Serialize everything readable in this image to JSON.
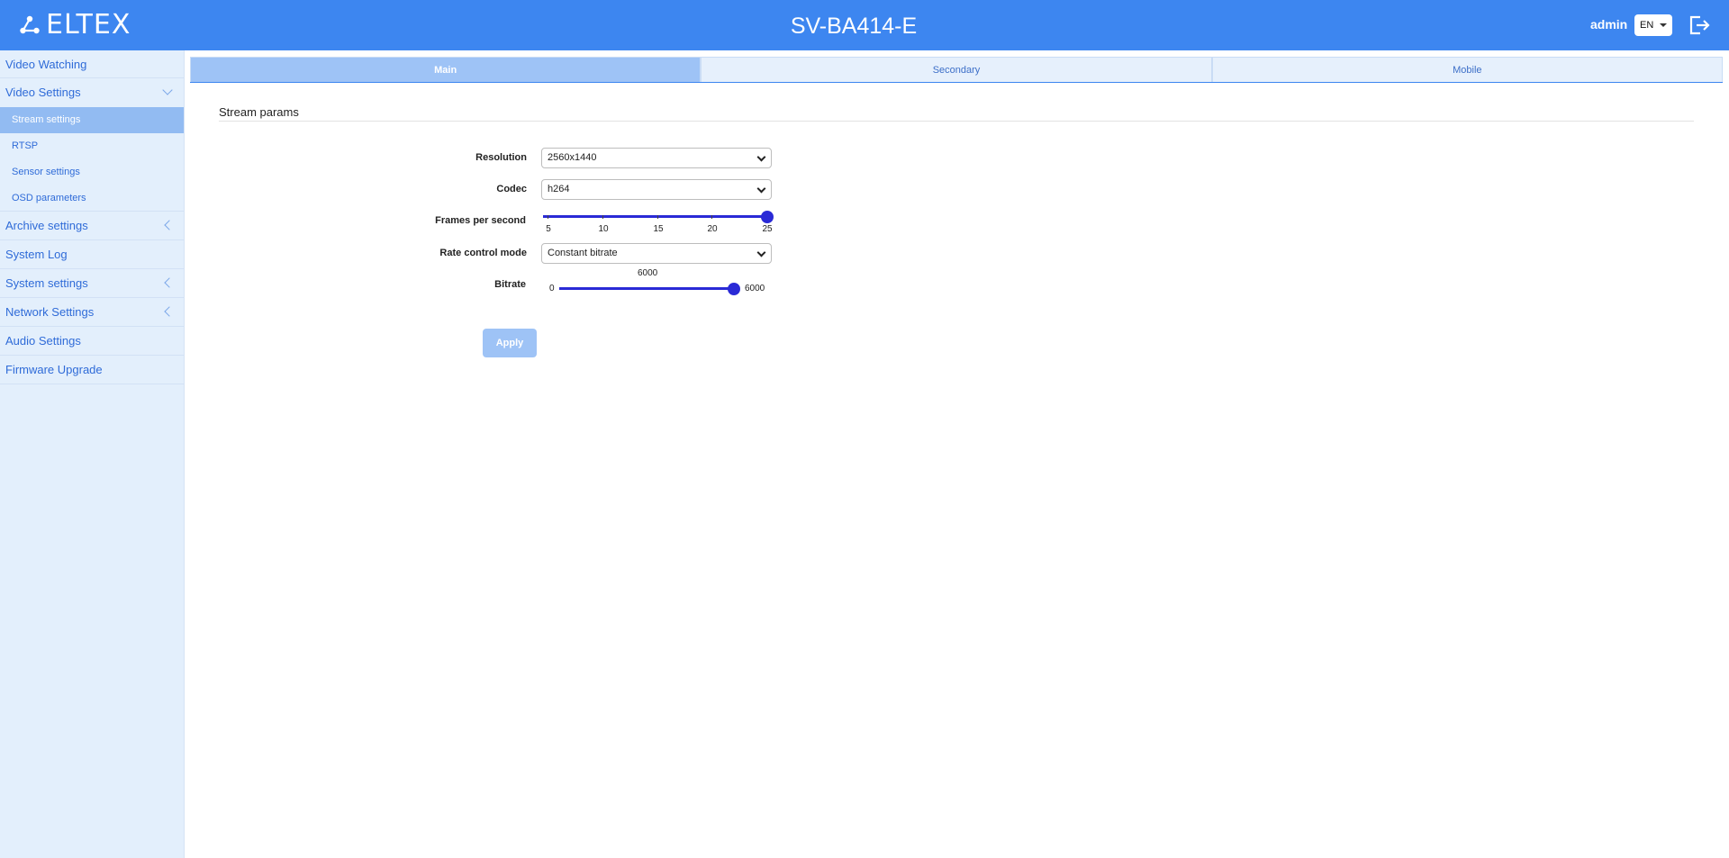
{
  "header": {
    "logo_text": "ELTEX",
    "device_title": "SV-BA414-E",
    "user": "admin",
    "language": "EN",
    "logout_icon": "logout-icon"
  },
  "sidebar": {
    "items": [
      {
        "label": "Video Watching"
      },
      {
        "label": "Video Settings",
        "expanded": true,
        "children": [
          {
            "label": "Stream settings",
            "active": true
          },
          {
            "label": "RTSP"
          },
          {
            "label": "Sensor settings"
          },
          {
            "label": "OSD parameters"
          }
        ]
      },
      {
        "label": "Archive settings"
      },
      {
        "label": "System Log"
      },
      {
        "label": "System settings"
      },
      {
        "label": "Network Settings"
      },
      {
        "label": "Audio Settings"
      },
      {
        "label": "Firmware Upgrade"
      }
    ]
  },
  "tabs": [
    {
      "label": "Main",
      "active": true
    },
    {
      "label": "Secondary"
    },
    {
      "label": "Mobile"
    }
  ],
  "form": {
    "section_title": "Stream params",
    "resolution": {
      "label": "Resolution",
      "value": "2560x1440"
    },
    "codec": {
      "label": "Codec",
      "value": "h264"
    },
    "fps": {
      "label": "Frames per second",
      "min": 5,
      "max": 25,
      "value": 25,
      "ticks": [
        "5",
        "10",
        "15",
        "20",
        "25"
      ]
    },
    "rate_control": {
      "label": "Rate control mode",
      "value": "Constant bitrate"
    },
    "bitrate": {
      "label": "Bitrate",
      "min": "0",
      "max": "6000",
      "value": "6000"
    },
    "apply_label": "Apply"
  },
  "colors": {
    "header": "#3d86f0",
    "sidebar": "#e3effc",
    "slider": "#2a2ad6",
    "active_tab": "#9ec3f6"
  }
}
